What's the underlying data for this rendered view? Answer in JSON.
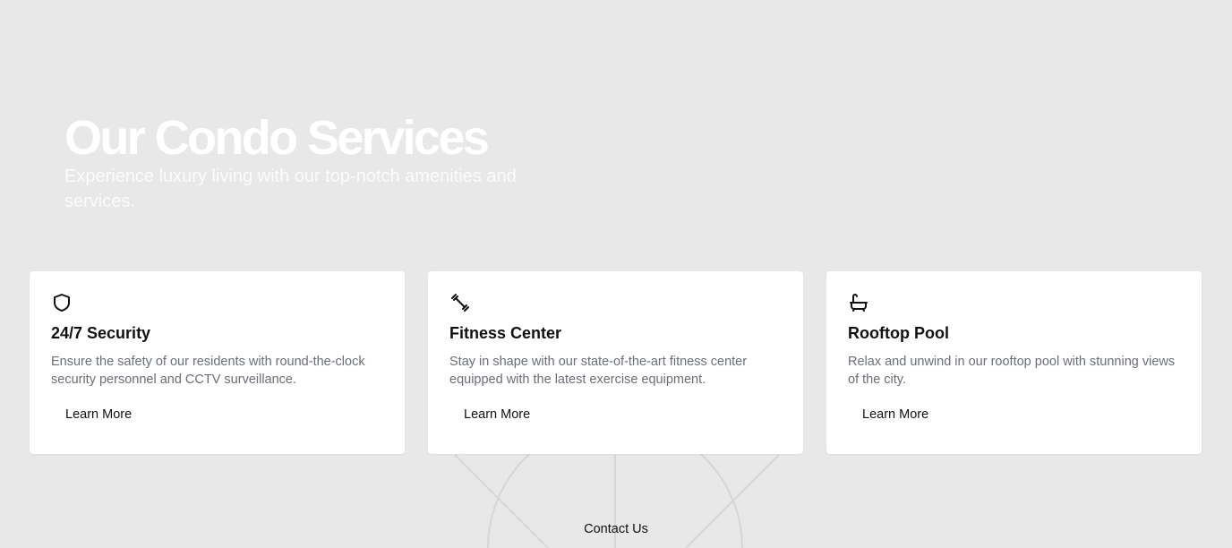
{
  "hero": {
    "title": "Our Condo Services",
    "subtitle": "Experience luxury living with our top-notch amenities and services."
  },
  "services": [
    {
      "icon": "shield-icon",
      "title": "24/7 Security",
      "description": "Ensure the safety of our residents with round-the-clock security personnel and CCTV surveillance.",
      "link_label": "Learn More"
    },
    {
      "icon": "dumbbell-icon",
      "title": "Fitness Center",
      "description": "Stay in shape with our state-of-the-art fitness center equipped with the latest exercise equipment.",
      "link_label": "Learn More"
    },
    {
      "icon": "bath-icon",
      "title": "Rooftop Pool",
      "description": "Relax and unwind in our rooftop pool with stunning views of the city.",
      "link_label": "Learn More"
    }
  ],
  "footer": {
    "contact_label": "Contact Us"
  },
  "colors": {
    "background": "#e8e8e8",
    "card": "#ffffff",
    "title_text": "#111111",
    "body_text": "#6b6f76",
    "hero_text": "#ffffff"
  }
}
